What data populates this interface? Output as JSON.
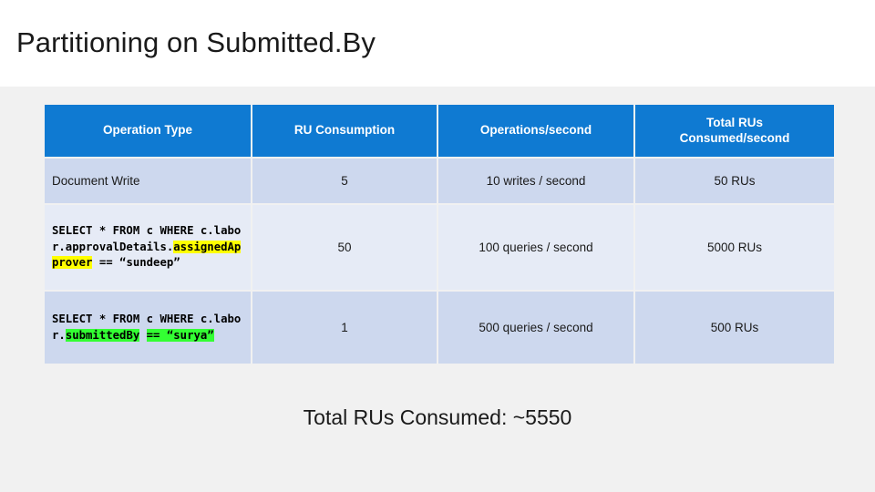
{
  "slide": {
    "title": "Partitioning on Submitted.By",
    "accent_color": "#0f7ad2",
    "row_band_dark": "#cdd8ee",
    "row_band_light": "#e6ebf6",
    "background": "#f1f1f1"
  },
  "table": {
    "headers": [
      "Operation Type",
      "RU Consumption",
      "Operations/second",
      "Total RUs\nConsumed/second"
    ],
    "header_line1": "Total RUs",
    "header_line2": "Consumed/second",
    "rows": [
      {
        "operation_plain": "Document Write",
        "ru_consumption": "5",
        "operations_per_second": "10 writes / second",
        "total_rus": "50 RUs"
      },
      {
        "query_parts": [
          {
            "text": "SELECT * FROM c WHERE c.labor.approvalDetai",
            "highlight": "none"
          },
          {
            "text": "ls.",
            "highlight": "none"
          },
          {
            "text": "assignedApprover",
            "highlight": "yellow"
          },
          {
            "text": " == “sundeep”",
            "highlight": "none"
          }
        ],
        "ru_consumption": "50",
        "operations_per_second": "100 queries / second",
        "total_rus": "5000 RUs"
      },
      {
        "query_parts": [
          {
            "text": "SELECT * FROM c WHERE c.labor.",
            "highlight": "none"
          },
          {
            "text": "submittedBy",
            "highlight": "green"
          },
          {
            "text": " ",
            "highlight": "none"
          },
          {
            "text": "== “surya”",
            "highlight": "green"
          }
        ],
        "ru_consumption": "1",
        "operations_per_second": "500 queries / second",
        "total_rus": "500 RUs"
      }
    ]
  },
  "footer": {
    "total_label": "Total RUs Consumed: ~5550"
  }
}
